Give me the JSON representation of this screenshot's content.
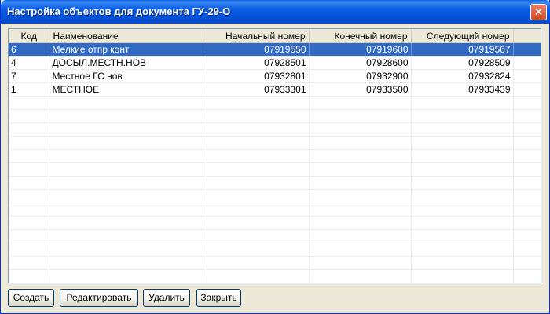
{
  "window": {
    "title": "Настройка объектов для документа ГУ-29-О",
    "close_glyph": "✕"
  },
  "grid": {
    "columns": {
      "code": "Код",
      "name": "Наименование",
      "start": "Начальный номер",
      "end": "Конечный номер",
      "next": "Следующий номер"
    },
    "rows": [
      {
        "code": "6",
        "name": "Мелкие отпр конт",
        "start": "07919550",
        "end": "07919600",
        "next": "07919567",
        "selected": true
      },
      {
        "code": "4",
        "name": "ДОСЫЛ.МЕСТН.НОВ",
        "start": "07928501",
        "end": "07928600",
        "next": "07928509",
        "selected": false
      },
      {
        "code": "7",
        "name": "Местное ГС нов",
        "start": "07932801",
        "end": "07932900",
        "next": "07932824",
        "selected": false
      },
      {
        "code": "1",
        "name": "МЕСТНОЕ",
        "start": "07933301",
        "end": "07933500",
        "next": "07933439",
        "selected": false
      }
    ]
  },
  "buttons": {
    "create": "Создать",
    "edit": "Редактировать",
    "delete": "Удалить",
    "close": "Закрыть"
  },
  "colors": {
    "title_bar": "#0a5ce3",
    "selection": "#316ac5",
    "window_bg": "#ece9d8"
  }
}
